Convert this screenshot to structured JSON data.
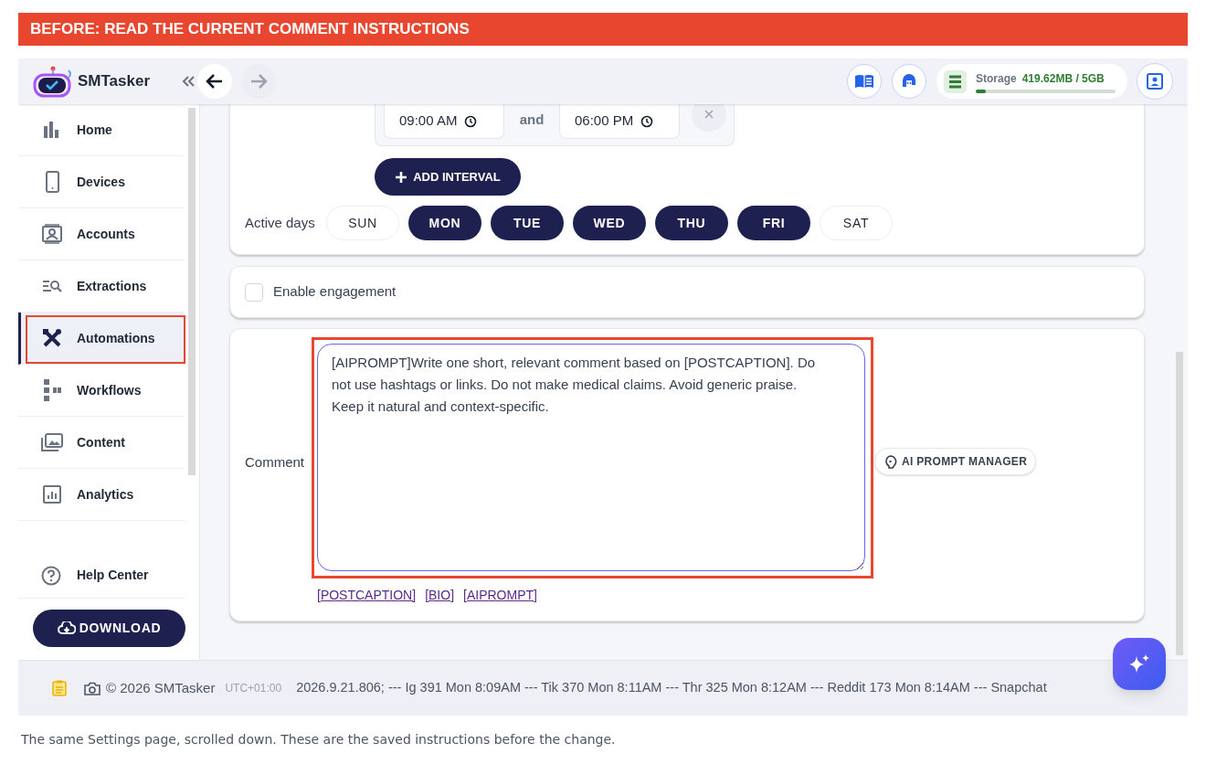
{
  "banner": {
    "text": "BEFORE: READ THE CURRENT COMMENT INSTRUCTIONS"
  },
  "header": {
    "brand": "SMTasker",
    "storage_label": "Storage",
    "storage_value": "419.62MB / 5GB",
    "storage": {
      "level": 0.07
    }
  },
  "sidebar": {
    "items": [
      {
        "label": "Home",
        "selected": false,
        "highlighted": false
      },
      {
        "label": "Devices",
        "selected": false,
        "highlighted": false
      },
      {
        "label": "Accounts",
        "selected": false,
        "highlighted": false
      },
      {
        "label": "Extractions",
        "selected": false,
        "highlighted": false
      },
      {
        "label": "Automations",
        "selected": true,
        "highlighted": true
      },
      {
        "label": "Workflows",
        "selected": false,
        "highlighted": false
      },
      {
        "label": "Content",
        "selected": false,
        "highlighted": false
      },
      {
        "label": "Analytics",
        "selected": false,
        "highlighted": false
      }
    ],
    "help": "Help Center",
    "download": "DOWNLOAD"
  },
  "schedule": {
    "intervals": [
      {
        "start": "09:00 AM",
        "joiner": "and",
        "end": "06:00 PM"
      }
    ],
    "add_interval": "ADD INTERVAL",
    "days_label": "Active days",
    "days": [
      {
        "label": "SUN",
        "selected": false
      },
      {
        "label": "MON",
        "selected": true
      },
      {
        "label": "TUE",
        "selected": true
      },
      {
        "label": "WED",
        "selected": true
      },
      {
        "label": "THU",
        "selected": true
      },
      {
        "label": "FRI",
        "selected": true
      },
      {
        "label": "SAT",
        "selected": false
      }
    ]
  },
  "engagement": {
    "label": "Enable engagement",
    "checked": false
  },
  "comment": {
    "label": "Comment",
    "value": "[AIPROMPT]Write one short, relevant comment based on [POSTCAPTION]. Do not use hashtags or links. Do not make medical claims. Avoid generic praise. Keep it natural and context-specific.",
    "highlighted": true,
    "tokens": [
      "[POSTCAPTION]",
      "[BIO]",
      "[AIPROMPT]"
    ],
    "prompt_manager": "AI PROMPT MANAGER"
  },
  "footer": {
    "copyright": "© 2026 SMTasker",
    "timezone": "UTC+01:00",
    "ticker": "2026.9.21.806; --- Ig 391 Mon 8:09AM --- Tik 370 Mon 8:11AM --- Thr 325 Mon 8:12AM --- Reddit 173 Mon 8:14AM --- Snapchat"
  },
  "caption": "The same Settings page, scrolled down. These are the saved instructions before the change."
}
